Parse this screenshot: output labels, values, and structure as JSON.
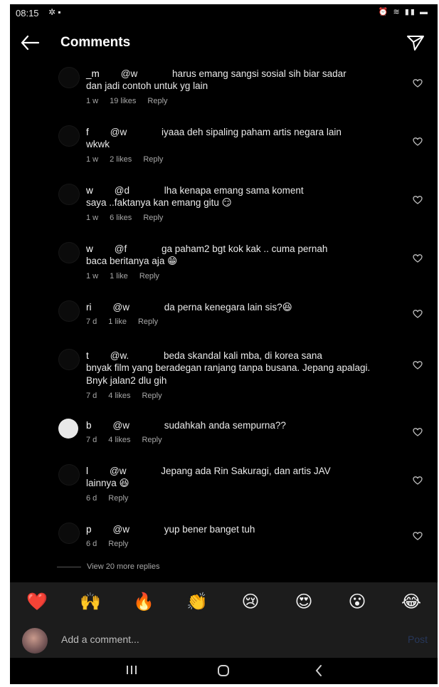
{
  "status_bar": {
    "time": "08:15"
  },
  "header": {
    "title": "Comments"
  },
  "comments": [
    {
      "username": "_m",
      "mention": "@w",
      "text": "harus emang sangsi sosial sih biar sadar",
      "text_line2": "dan jadi contoh untuk yg lain",
      "time": "1 w",
      "likes": "19 likes",
      "reply": "Reply",
      "avatar": "dark"
    },
    {
      "username": "f",
      "mention": "@w",
      "text": "iyaaa deh sipaling paham artis negara lain",
      "text_line2": "wkwk",
      "time": "1 w",
      "likes": "2 likes",
      "reply": "Reply",
      "avatar": "dark"
    },
    {
      "username": "w",
      "mention": "@d",
      "text": "lha kenapa emang sama koment",
      "text_line2": "saya ..faktanya kan emang gitu 😏",
      "time": "1 w",
      "likes": "6 likes",
      "reply": "Reply",
      "avatar": "dark"
    },
    {
      "username": "w",
      "mention": "@f",
      "text": "ga paham2 bgt kok kak .. cuma pernah",
      "text_line2": "baca beritanya aja 😁",
      "time": "1 w",
      "likes": "1 like",
      "reply": "Reply",
      "avatar": "dark"
    },
    {
      "username": "ri",
      "mention": "@w",
      "text": "da perna kenegara lain sis?😆",
      "text_line2": "",
      "time": "7 d",
      "likes": "1 like",
      "reply": "Reply",
      "avatar": "dark"
    },
    {
      "username": "t",
      "mention": "@w.",
      "text": "beda skandal kali mba, di korea sana",
      "text_line2": "bnyak film yang beradegan ranjang tanpa busana. Jepang apalagi.",
      "text_line3": "Bnyk jalan2 dlu gih",
      "time": "7 d",
      "likes": "4 likes",
      "reply": "Reply",
      "avatar": "dark"
    },
    {
      "username": "b",
      "mention": "@w",
      "text": "sudahkah anda sempurna??",
      "text_line2": "",
      "time": "7 d",
      "likes": "4 likes",
      "reply": "Reply",
      "avatar": "white"
    },
    {
      "username": "l",
      "mention": "@w",
      "text": "Jepang ada Rin Sakuragi, dan artis JAV",
      "text_line2": "lainnya 😆",
      "time": "6 d",
      "likes": "",
      "reply": "Reply",
      "avatar": "dark"
    },
    {
      "username": "p",
      "mention": "@w",
      "text": "yup bener banget tuh",
      "text_line2": "",
      "time": "6 d",
      "likes": "",
      "reply": "Reply",
      "avatar": "dark"
    }
  ],
  "view_more_replies": "View 20 more replies",
  "reactions": [
    "❤️",
    "🙌",
    "🔥",
    "👏",
    "😢",
    "😍",
    "😮",
    "😂"
  ],
  "compose": {
    "placeholder": "Add a comment...",
    "post_label": "Post"
  }
}
